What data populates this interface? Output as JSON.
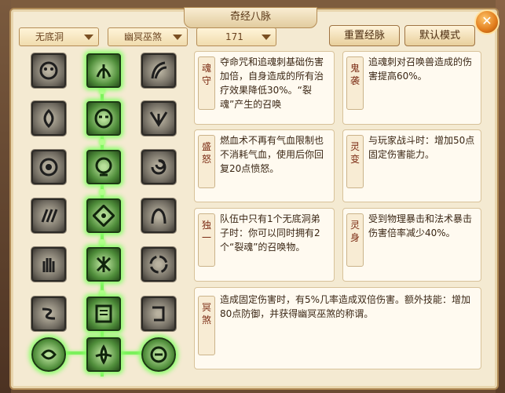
{
  "window": {
    "title": "奇经八脉",
    "close_label": "✕"
  },
  "toolbar": {
    "school_select": "无底洞",
    "path_select": "幽冥巫煞",
    "level_select": "171",
    "reset_button": "重置经脉",
    "default_button": "默认模式"
  },
  "skill_tree": {
    "icons": {
      "left": [
        "ghost-face-icon",
        "flame-icon",
        "spiral-eye-icon",
        "claw-icon",
        "hand-icon",
        "serpent-icon",
        "dragon-knot-icon"
      ],
      "middle": [
        "leaf-spirit-icon",
        "mask-icon",
        "skull-icon",
        "vortex-icon",
        "rune-icon",
        "book-icon",
        "lotus-icon"
      ],
      "right": [
        "horn-icon",
        "wing-icon",
        "whirl-icon",
        "beast-icon",
        "swirl-icon",
        "scroll-icon",
        "seal-icon"
      ]
    },
    "active_color": "#7cf05c"
  },
  "cards": [
    {
      "label": "魂\n守",
      "text": "夺命咒和追魂刺基础伤害加倍，自身造成的所有治疗效果降低30%。“裂魂”产生的召唤"
    },
    {
      "label": "鬼\n袭",
      "text": "追魂刺对召唤兽造成的伤害提高60%。"
    },
    {
      "label": "盛\n怒",
      "text": "燃血术不再有气血限制也不消耗气血，使用后你回复20点愤怒。"
    },
    {
      "label": "灵\n变",
      "text": "与玩家战斗时：增加50点固定伤害能力。"
    },
    {
      "label": "独\n一",
      "text": "队伍中只有1个无底洞弟子时：你可以同时拥有2个“裂魂”的召唤物。"
    },
    {
      "label": "灵\n身",
      "text": "受到物理暴击和法术暴击伤害倍率减少40%。"
    },
    {
      "label": "冥\n煞",
      "text": "造成固定伤害时，有5%几率造成双倍伤害。额外技能：增加80点防御，并获得幽冥巫煞的称谓。"
    }
  ]
}
